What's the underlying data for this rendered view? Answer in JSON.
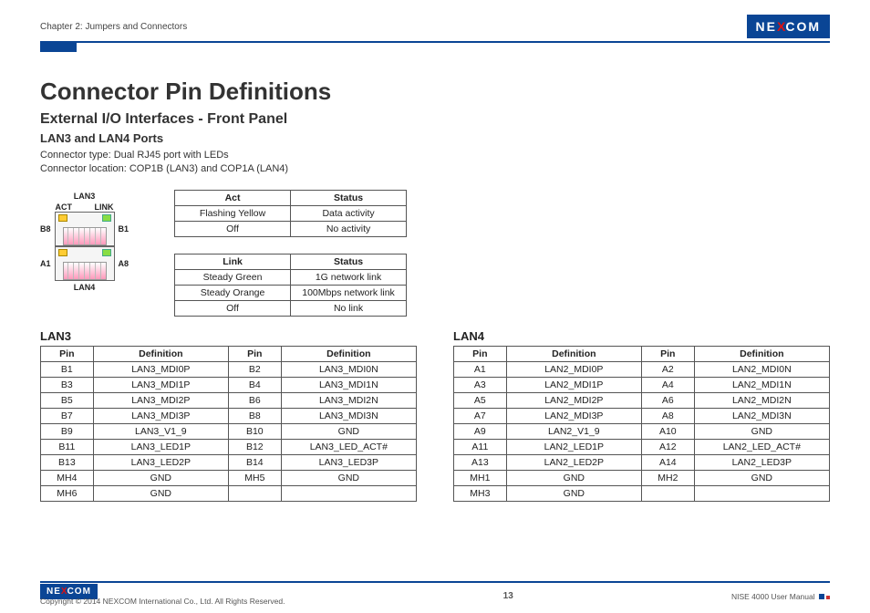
{
  "header": {
    "chapter": "Chapter 2: Jumpers and Connectors",
    "brand_pre": "NE",
    "brand_x": "X",
    "brand_post": "COM"
  },
  "titles": {
    "h1": "Connector Pin Definitions",
    "h2": "External I/O Interfaces - Front Panel",
    "h3": "LAN3 and LAN4 Ports",
    "meta1": "Connector type: Dual RJ45 port with LEDs",
    "meta2": "Connector location: COP1B (LAN3) and COP1A (LAN4)"
  },
  "diagram": {
    "top": "LAN3",
    "bottom": "LAN4",
    "act": "ACT",
    "link": "LINK",
    "b8": "B8",
    "b1": "B1",
    "a1": "A1",
    "a8": "A8"
  },
  "act_table": {
    "h1": "Act",
    "h2": "Status",
    "rows": [
      [
        "Flashing Yellow",
        "Data activity"
      ],
      [
        "Off",
        "No activity"
      ]
    ]
  },
  "link_table": {
    "h1": "Link",
    "h2": "Status",
    "rows": [
      [
        "Steady Green",
        "1G network link"
      ],
      [
        "Steady Orange",
        "100Mbps network link"
      ],
      [
        "Off",
        "No link"
      ]
    ]
  },
  "lan3": {
    "title": "LAN3",
    "headers": [
      "Pin",
      "Definition",
      "Pin",
      "Definition"
    ],
    "rows": [
      [
        "B1",
        "LAN3_MDI0P",
        "B2",
        "LAN3_MDI0N"
      ],
      [
        "B3",
        "LAN3_MDI1P",
        "B4",
        "LAN3_MDI1N"
      ],
      [
        "B5",
        "LAN3_MDI2P",
        "B6",
        "LAN3_MDI2N"
      ],
      [
        "B7",
        "LAN3_MDI3P",
        "B8",
        "LAN3_MDI3N"
      ],
      [
        "B9",
        "LAN3_V1_9",
        "B10",
        "GND"
      ],
      [
        "B11",
        "LAN3_LED1P",
        "B12",
        "LAN3_LED_ACT#"
      ],
      [
        "B13",
        "LAN3_LED2P",
        "B14",
        "LAN3_LED3P"
      ],
      [
        "MH4",
        "GND",
        "MH5",
        "GND"
      ],
      [
        "MH6",
        "GND",
        "",
        ""
      ]
    ]
  },
  "lan4": {
    "title": "LAN4",
    "headers": [
      "Pin",
      "Definition",
      "Pin",
      "Definition"
    ],
    "rows": [
      [
        "A1",
        "LAN2_MDI0P",
        "A2",
        "LAN2_MDI0N"
      ],
      [
        "A3",
        "LAN2_MDI1P",
        "A4",
        "LAN2_MDI1N"
      ],
      [
        "A5",
        "LAN2_MDI2P",
        "A6",
        "LAN2_MDI2N"
      ],
      [
        "A7",
        "LAN2_MDI3P",
        "A8",
        "LAN2_MDI3N"
      ],
      [
        "A9",
        "LAN2_V1_9",
        "A10",
        "GND"
      ],
      [
        "A11",
        "LAN2_LED1P",
        "A12",
        "LAN2_LED_ACT#"
      ],
      [
        "A13",
        "LAN2_LED2P",
        "A14",
        "LAN2_LED3P"
      ],
      [
        "MH1",
        "GND",
        "MH2",
        "GND"
      ],
      [
        "MH3",
        "GND",
        "",
        ""
      ]
    ]
  },
  "footer": {
    "copyright": "Copyright © 2014 NEXCOM International Co., Ltd. All Rights Reserved.",
    "page": "13",
    "manual": "NISE 4000 User Manual"
  }
}
